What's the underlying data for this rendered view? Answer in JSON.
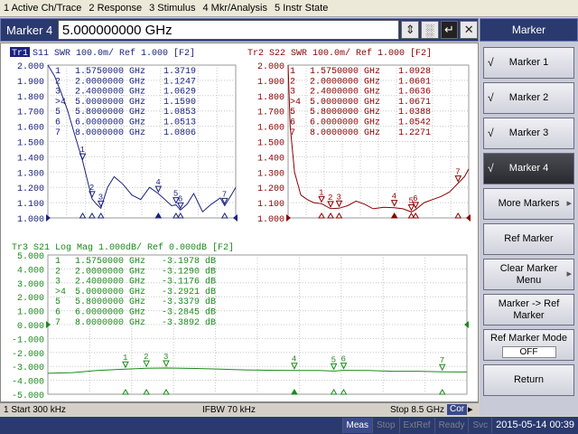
{
  "menu": [
    "1 Active Ch/Trace",
    "2 Response",
    "3 Stimulus",
    "4 Mkr/Analysis",
    "5 Instr State"
  ],
  "entry": {
    "label": "Marker 4",
    "value": "5.000000000 GHz"
  },
  "softkeys": {
    "title": "Marker",
    "items": [
      {
        "label": "Marker 1",
        "checked": true
      },
      {
        "label": "Marker 2",
        "checked": true
      },
      {
        "label": "Marker 3",
        "checked": true
      },
      {
        "label": "Marker 4",
        "checked": true,
        "selected": true
      },
      {
        "label": "More Markers"
      },
      {
        "label": "Ref Marker"
      },
      {
        "label": "Clear Marker Menu"
      },
      {
        "label": "Marker -> Ref Marker"
      },
      {
        "label": "Ref Marker Mode",
        "value": "OFF"
      },
      {
        "label": "Return"
      }
    ]
  },
  "status": {
    "start": "1  Start 300 kHz",
    "ifbw": "IFBW 70 kHz",
    "stop": "Stop 8.5 GHz",
    "cor": "Cor"
  },
  "instbar": {
    "items": [
      "Meas",
      "Stop",
      "ExtRef",
      "Ready",
      "Svc"
    ],
    "clock": "2015-05-14 00:39"
  },
  "colors": {
    "tr1": "#1a237e",
    "tr2": "#8b0000",
    "tr3": "#1b8a1b"
  },
  "chart_data": [
    {
      "type": "line",
      "title": "Tr1  S11  SWR 100.0m/ Ref 1.000  [F2]",
      "trace_tag": "Tr1",
      "y_ticks": [
        "2.000",
        "1.900",
        "1.800",
        "1.700",
        "1.600",
        "1.500",
        "1.400",
        "1.300",
        "1.200",
        "1.100",
        "1.000"
      ],
      "ylim": [
        1.0,
        2.0
      ],
      "xlim": [
        0.0003,
        8.5
      ],
      "markers": [
        {
          "id": "1",
          "freq": "1.5750000 GHz",
          "value": "1.3719"
        },
        {
          "id": "2",
          "freq": "2.0000000 GHz",
          "value": "1.1247"
        },
        {
          "id": "3",
          "freq": "2.4000000 GHz",
          "value": "1.0629"
        },
        {
          "id": ">4",
          "freq": "5.0000000 GHz",
          "value": "1.1590"
        },
        {
          "id": "5",
          "freq": "5.8000000 GHz",
          "value": "1.0853"
        },
        {
          "id": "6",
          "freq": "6.0000000 GHz",
          "value": "1.0513"
        },
        {
          "id": "7",
          "freq": "8.0000000 GHz",
          "value": "1.0806"
        }
      ],
      "x": [
        0.0003,
        0.3,
        0.6,
        0.9,
        1.2,
        1.575,
        1.8,
        2.0,
        2.2,
        2.4,
        2.7,
        3.0,
        3.4,
        3.8,
        4.2,
        4.6,
        5.0,
        5.3,
        5.6,
        5.8,
        6.0,
        6.3,
        6.6,
        7.0,
        7.4,
        7.8,
        8.0,
        8.3,
        8.5
      ],
      "y": [
        2.0,
        1.93,
        1.82,
        1.7,
        1.55,
        1.3719,
        1.24,
        1.1247,
        1.09,
        1.0629,
        1.2,
        1.27,
        1.22,
        1.15,
        1.12,
        1.2,
        1.159,
        1.12,
        1.08,
        1.0853,
        1.0513,
        1.09,
        1.16,
        1.04,
        1.09,
        1.13,
        1.0806,
        1.15,
        1.2
      ]
    },
    {
      "type": "line",
      "title": "Tr2  S22  SWR 100.0m/ Ref 1.000  [F2]",
      "y_ticks": [
        "2.000",
        "1.900",
        "1.800",
        "1.700",
        "1.600",
        "1.500",
        "1.400",
        "1.300",
        "1.200",
        "1.100",
        "1.000"
      ],
      "ylim": [
        1.0,
        2.0
      ],
      "xlim": [
        0.0003,
        8.5
      ],
      "markers": [
        {
          "id": "1",
          "freq": "1.5750000 GHz",
          "value": "1.0928"
        },
        {
          "id": "2",
          "freq": "2.0000000 GHz",
          "value": "1.0601"
        },
        {
          "id": "3",
          "freq": "2.4000000 GHz",
          "value": "1.0636"
        },
        {
          "id": ">4",
          "freq": "5.0000000 GHz",
          "value": "1.0671"
        },
        {
          "id": "5",
          "freq": "5.8000000 GHz",
          "value": "1.0388"
        },
        {
          "id": "6",
          "freq": "6.0000000 GHz",
          "value": "1.0542"
        },
        {
          "id": "7",
          "freq": "8.0000000 GHz",
          "value": "1.2271"
        }
      ],
      "x": [
        0.0003,
        0.1,
        0.3,
        0.6,
        0.9,
        1.2,
        1.575,
        2.0,
        2.4,
        2.8,
        3.2,
        3.6,
        4.0,
        4.5,
        5.0,
        5.4,
        5.8,
        6.0,
        6.4,
        6.8,
        7.2,
        7.6,
        8.0,
        8.3,
        8.5
      ],
      "y": [
        2.0,
        1.6,
        1.3,
        1.15,
        1.12,
        1.1,
        1.0928,
        1.0601,
        1.0636,
        1.08,
        1.11,
        1.09,
        1.06,
        1.07,
        1.0671,
        1.06,
        1.0388,
        1.0542,
        1.1,
        1.12,
        1.14,
        1.17,
        1.2271,
        1.27,
        1.32
      ]
    },
    {
      "type": "line",
      "title": "Tr3  S21  Log Mag 1.000dB/ Ref 0.000dB  [F2]",
      "y_ticks": [
        "5.000",
        "4.000",
        "3.000",
        "2.000",
        "1.000",
        "0.000",
        "-1.000",
        "-2.000",
        "-3.000",
        "-4.000",
        "-5.000"
      ],
      "ylim": [
        -5.0,
        5.0
      ],
      "xlim": [
        0.0003,
        8.5
      ],
      "markers": [
        {
          "id": "1",
          "freq": "1.5750000 GHz",
          "value": "-3.1978 dB"
        },
        {
          "id": "2",
          "freq": "2.0000000 GHz",
          "value": "-3.1290 dB"
        },
        {
          "id": "3",
          "freq": "2.4000000 GHz",
          "value": "-3.1176 dB"
        },
        {
          "id": ">4",
          "freq": "5.0000000 GHz",
          "value": "-3.2921 dB"
        },
        {
          "id": "5",
          "freq": "5.8000000 GHz",
          "value": "-3.3379 dB"
        },
        {
          "id": "6",
          "freq": "6.0000000 GHz",
          "value": "-3.2845 dB"
        },
        {
          "id": "7",
          "freq": "8.0000000 GHz",
          "value": "-3.3892 dB"
        }
      ],
      "x": [
        0.0003,
        0.5,
        1.0,
        1.575,
        2.0,
        2.4,
        3.0,
        3.5,
        4.0,
        4.5,
        5.0,
        5.5,
        5.8,
        6.0,
        6.5,
        7.0,
        7.5,
        8.0,
        8.5
      ],
      "y": [
        -3.5,
        -3.45,
        -3.3,
        -3.1978,
        -3.129,
        -3.1176,
        -3.15,
        -3.2,
        -3.25,
        -3.28,
        -3.2921,
        -3.3,
        -3.3379,
        -3.2845,
        -3.3,
        -3.35,
        -3.35,
        -3.3892,
        -3.4
      ]
    }
  ]
}
